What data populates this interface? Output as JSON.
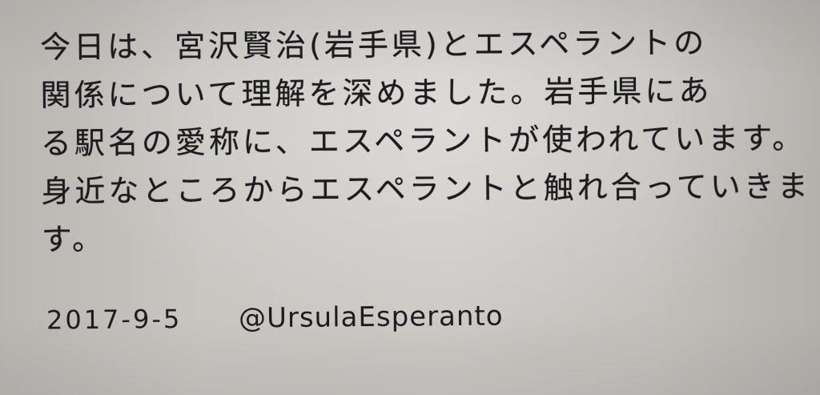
{
  "note": {
    "lines": [
      "今日は、宮沢賢治(岩手県)とエスペラントの",
      "関係について理解を深めました。岩手県にあ",
      "る駅名の愛称に、エスペラントが使われています。",
      "身近なところからエスペラントと触れ合っていきま",
      "す。"
    ]
  },
  "signature": {
    "date": "2017-9-5",
    "handle": "@UrsulaEsperanto"
  }
}
